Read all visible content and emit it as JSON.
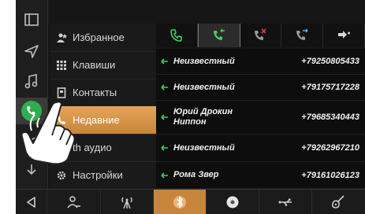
{
  "menu": {
    "items": [
      {
        "label": "Избранное",
        "icon": "favorites-person-icon"
      },
      {
        "label": "Клавиши",
        "icon": "keypad-icon"
      },
      {
        "label": "Контакты",
        "icon": "contacts-book-icon"
      },
      {
        "label": "Недавние",
        "icon": "recent-calls-icon"
      },
      {
        "label": "th аудио",
        "icon": "bt-audio-icon"
      },
      {
        "label": "Настройки",
        "icon": "settings-gear-icon"
      }
    ],
    "active_index": 3
  },
  "tabs": [
    {
      "icon": "phone-icon"
    },
    {
      "icon": "incoming-call-icon"
    },
    {
      "icon": "missed-call-icon"
    },
    {
      "icon": "outgoing-call-icon"
    },
    {
      "icon": "call-log-more-icon"
    }
  ],
  "calls": [
    {
      "name": "Неизвестный",
      "number": "+79250805433"
    },
    {
      "name": "Неизвестный",
      "number": "+79175717228"
    },
    {
      "name": "Юрий Дрокин Ниппон",
      "number": "+79685340443"
    },
    {
      "name": "Неизвестный",
      "number": "+79262967210"
    },
    {
      "name": "Рома Звер",
      "number": "+79161026123"
    }
  ],
  "bottom_bar": [
    {
      "icon": "contacts-people-icon"
    },
    {
      "icon": "antenna-icon"
    },
    {
      "icon": "bluetooth-icon"
    },
    {
      "icon": "disc-icon"
    },
    {
      "icon": "usb-icon"
    },
    {
      "icon": "aux-guitar-icon"
    }
  ],
  "colors": {
    "accent": "#c8853a",
    "call_green": "#2fae4e",
    "text": "#f0f0f0"
  }
}
